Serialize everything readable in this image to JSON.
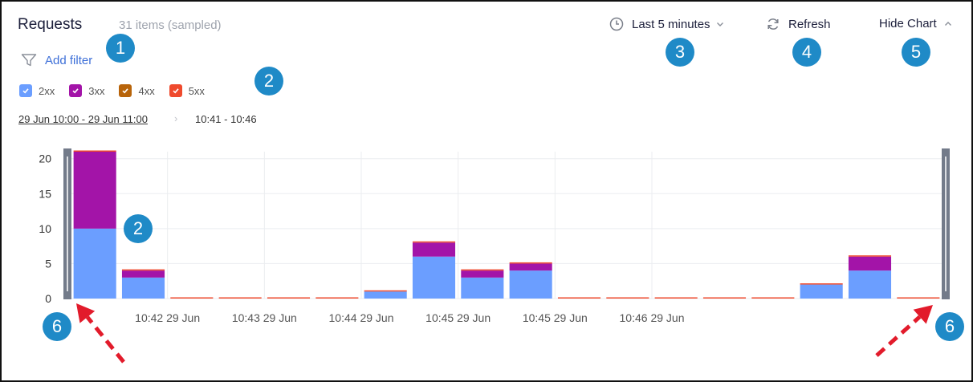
{
  "header": {
    "title": "Requests",
    "count_text": "31 items (sampled)",
    "time_range_label": "Last 5 minutes",
    "refresh_label": "Refresh",
    "hide_chart_label": "Hide Chart"
  },
  "filter": {
    "add_filter_label": "Add filter"
  },
  "legend": [
    {
      "label": "2xx",
      "color": "#6b9eff"
    },
    {
      "label": "3xx",
      "color": "#a314a8"
    },
    {
      "label": "4xx",
      "color": "#b8640a"
    },
    {
      "label": "5xx",
      "color": "#ef4a2d"
    }
  ],
  "breadcrumb": {
    "range": "29 Jun 10:00 - 29 Jun 11:00",
    "separator": "›",
    "selection": "10:41 - 10:46"
  },
  "annotations": [
    "1",
    "2",
    "3",
    "4",
    "5",
    "6",
    "2",
    "6"
  ],
  "chart_data": {
    "type": "bar",
    "stacked": true,
    "ylim": [
      0,
      21
    ],
    "yticks": [
      0,
      5,
      10,
      15,
      20
    ],
    "xtick_labels": [
      "10:42 29 Jun",
      "10:43 29 Jun",
      "10:44 29 Jun",
      "10:45 29 Jun",
      "10:45 29 Jun",
      "10:46 29 Jun"
    ],
    "series": [
      {
        "name": "2xx",
        "values": [
          10,
          3,
          0,
          0,
          0,
          0,
          1,
          6,
          3,
          4,
          0,
          0,
          0,
          0,
          0,
          2,
          4,
          0
        ]
      },
      {
        "name": "3xx",
        "values": [
          11,
          1,
          0,
          0,
          0,
          0,
          0,
          2,
          1,
          1,
          0,
          0,
          0,
          0,
          0,
          0,
          2,
          0
        ]
      },
      {
        "name": "4xx",
        "values": [
          0,
          0,
          0,
          0,
          0,
          0,
          0,
          0,
          0,
          0,
          0,
          0,
          0,
          0,
          0,
          0,
          0,
          0
        ]
      },
      {
        "name": "5xx",
        "values": [
          0,
          0,
          0,
          0,
          0,
          0,
          0,
          0,
          0,
          0,
          0,
          0,
          0,
          0,
          0,
          0,
          0,
          0
        ]
      }
    ],
    "grid": true
  }
}
